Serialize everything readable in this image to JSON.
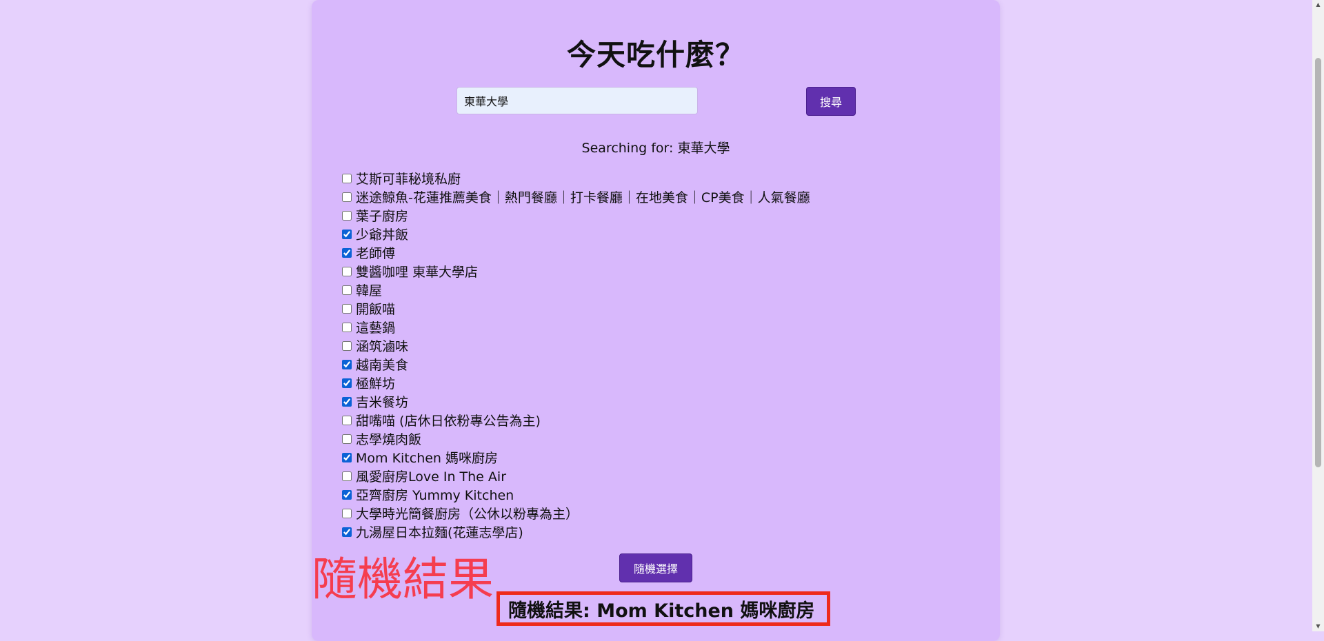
{
  "page": {
    "title": "今天吃什麼？"
  },
  "search": {
    "value": "東華大學",
    "button_label": "搜尋",
    "status_label": "Searching for: 東華大學"
  },
  "restaurants": [
    {
      "name": "艾斯可菲秘境私廚",
      "checked": false
    },
    {
      "name": "迷途鯨魚-花蓮推薦美食｜熱門餐廳｜打卡餐廳｜在地美食｜CP美食｜人氣餐廳",
      "checked": false
    },
    {
      "name": "葉子廚房",
      "checked": false
    },
    {
      "name": "少爺丼飯",
      "checked": true
    },
    {
      "name": "老師傅",
      "checked": true
    },
    {
      "name": "雙醬咖哩 東華大學店",
      "checked": false
    },
    {
      "name": "韓屋",
      "checked": false
    },
    {
      "name": "開飯喵",
      "checked": false
    },
    {
      "name": "這藝鍋",
      "checked": false
    },
    {
      "name": "涵筑滷味",
      "checked": false
    },
    {
      "name": "越南美食",
      "checked": true
    },
    {
      "name": "極鮮坊",
      "checked": true
    },
    {
      "name": "吉米餐坊",
      "checked": true
    },
    {
      "name": "甜嘴喵 (店休日依粉專公告為主)",
      "checked": false
    },
    {
      "name": "志學燒肉飯",
      "checked": false
    },
    {
      "name": "Mom Kitchen 媽咪廚房",
      "checked": true
    },
    {
      "name": "風愛廚房Love In The Air",
      "checked": false
    },
    {
      "name": "亞齊廚房 Yummy Kitchen",
      "checked": true
    },
    {
      "name": "大學時光簡餐廚房（公休以粉專為主）",
      "checked": false
    },
    {
      "name": "九湯屋日本拉麵(花蓮志學店)",
      "checked": true
    }
  ],
  "random": {
    "button_label": "隨機選擇",
    "result_text": "隨機結果: Mom Kitchen 媽咪廚房"
  },
  "annotation": {
    "text": "隨機結果",
    "color": "#f53d4f"
  },
  "colors": {
    "page_bg": "#e6d1fd",
    "card_bg": "#d8b8fc",
    "button_bg": "#6130ae",
    "highlight_border": "#ee2a1c"
  }
}
